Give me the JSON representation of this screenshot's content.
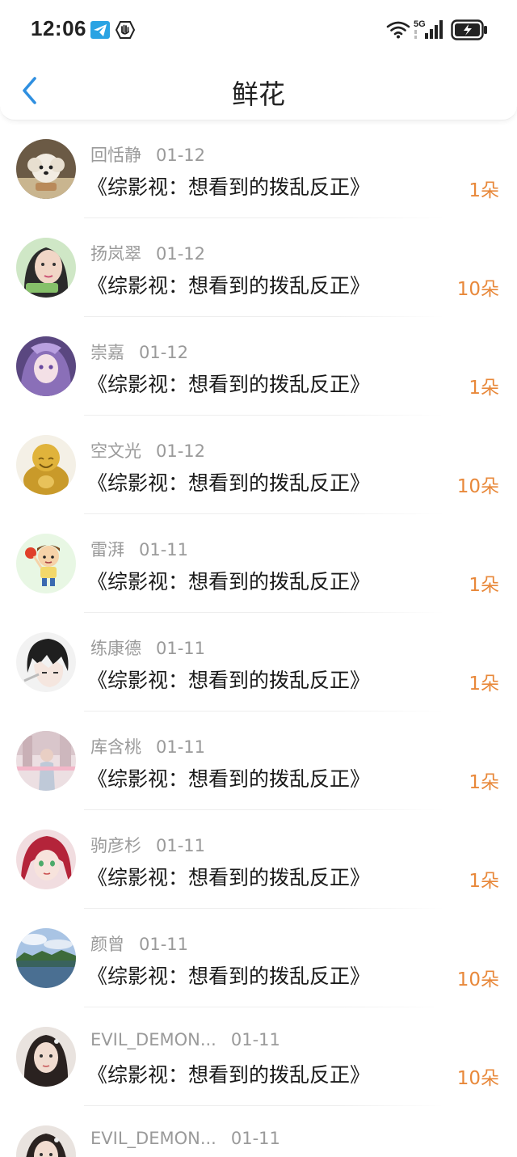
{
  "status_bar": {
    "time": "12:06",
    "network_label": "5G",
    "icons": [
      "telegram-icon",
      "hand-shield-icon",
      "wifi-icon",
      "signal-5g-icon",
      "battery-charging-icon"
    ]
  },
  "nav": {
    "back_icon": "chevron-left-icon",
    "title": "鲜花",
    "accent": "#2f8fe0"
  },
  "colors": {
    "count": "#e8883a",
    "meta": "#9a9a9a"
  },
  "items": [
    {
      "name": "回恬静",
      "date": "01-12",
      "title": "《综影视：想看到的拨乱反正》",
      "count": "1朵",
      "avatar": "dog-avatar"
    },
    {
      "name": "扬岚翠",
      "date": "01-12",
      "title": "《综影视：想看到的拨乱反正》",
      "count": "10朵",
      "avatar": "girl-avatar"
    },
    {
      "name": "崇嘉",
      "date": "01-12",
      "title": "《综影视：想看到的拨乱反正》",
      "count": "1朵",
      "avatar": "anime-purple-avatar"
    },
    {
      "name": "空文光",
      "date": "01-12",
      "title": "《综影视：想看到的拨乱反正》",
      "count": "10朵",
      "avatar": "golden-buddha-avatar"
    },
    {
      "name": "雷湃",
      "date": "01-11",
      "title": "《综影视：想看到的拨乱反正》",
      "count": "1朵",
      "avatar": "cartoon-boy-avatar"
    },
    {
      "name": "练康德",
      "date": "01-11",
      "title": "《综影视：想看到的拨乱反正》",
      "count": "1朵",
      "avatar": "anime-boy-avatar"
    },
    {
      "name": "库含桃",
      "date": "01-11",
      "title": "《综影视：想看到的拨乱反正》",
      "count": "1朵",
      "avatar": "pastel-photo-avatar"
    },
    {
      "name": "驹彦杉",
      "date": "01-11",
      "title": "《综影视：想看到的拨乱反正》",
      "count": "1朵",
      "avatar": "anime-redhair-avatar"
    },
    {
      "name": "颜曾",
      "date": "01-11",
      "title": "《综影视：想看到的拨乱反正》",
      "count": "10朵",
      "avatar": "landscape-avatar"
    },
    {
      "name": "EVIL_DEMON...",
      "date": "01-11",
      "title": "《综影视：想看到的拨乱反正》",
      "count": "10朵",
      "avatar": "woman-portrait-avatar"
    },
    {
      "name": "EVIL_DEMON...",
      "date": "01-11",
      "title": "",
      "count": "",
      "avatar": "woman-portrait-avatar"
    }
  ]
}
